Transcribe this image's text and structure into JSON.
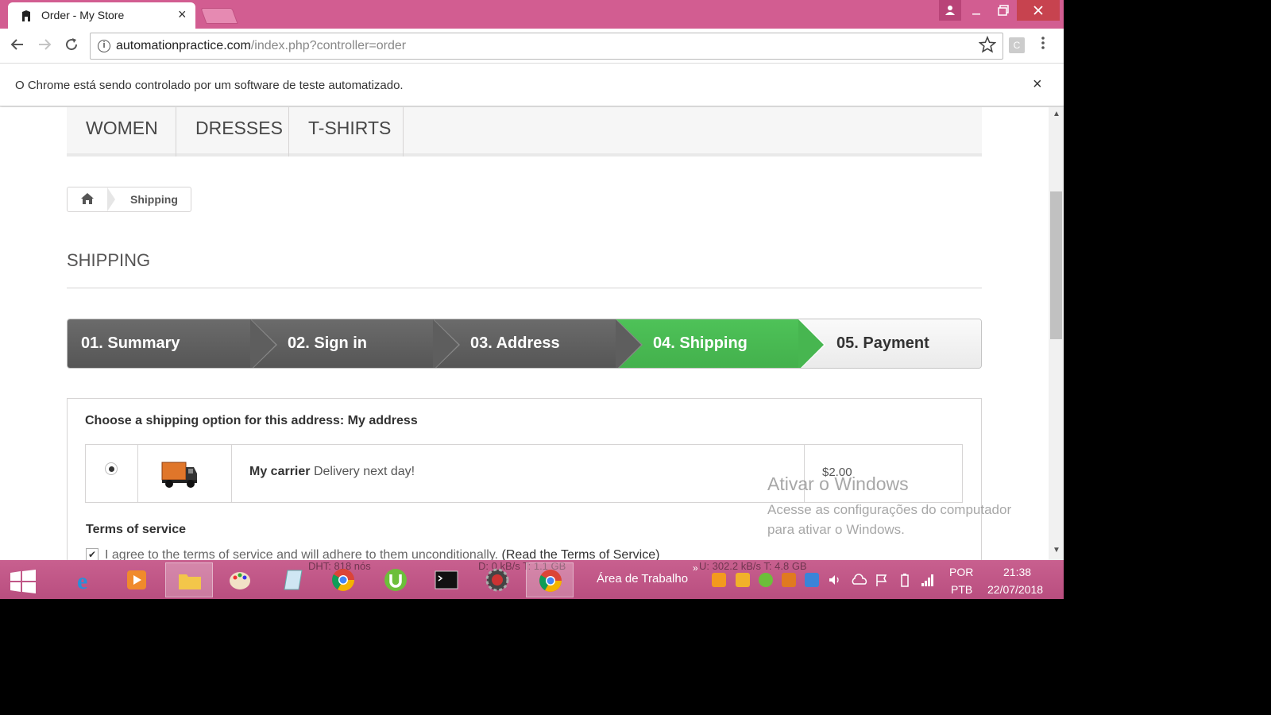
{
  "browser": {
    "tab_title": "Order - My Store",
    "tab_close": "×",
    "url_host": "automationpractice.com",
    "url_path": "/index.php?controller=order",
    "infobar_text": "O Chrome está sendo controlado por um software de teste automatizado.",
    "infobar_close": "×",
    "ext_label": "C"
  },
  "store": {
    "menu": [
      "WOMEN",
      "DRESSES",
      "T-SHIRTS"
    ],
    "breadcrumb_current": "Shipping",
    "page_heading": "SHIPPING",
    "steps": [
      {
        "label": "01. Summary",
        "state": "done"
      },
      {
        "label": "02. Sign in",
        "state": "done"
      },
      {
        "label": "03. Address",
        "state": "done"
      },
      {
        "label": "04. Shipping",
        "state": "current"
      },
      {
        "label": "05. Payment",
        "state": "todo"
      }
    ],
    "shipping_title": "Choose a shipping option for this address: My address",
    "carrier": {
      "name": "My carrier",
      "description": "Delivery next day!",
      "price": "$2.00",
      "selected": true
    },
    "terms_title": "Terms of service",
    "terms_text": "I agree to the terms of service and will adhere to them unconditionally.",
    "terms_link": "(Read the Terms of Service)",
    "terms_checked": true
  },
  "watermark": {
    "title": "Ativar o Windows",
    "subtitle": "Acesse as configurações do computador para ativar o Windows."
  },
  "taskbar": {
    "desktop_label": "Área de Trabalho",
    "chevron": "»",
    "lang_line1": "POR",
    "lang_line2": "PTB",
    "time": "21:38",
    "date": "22/07/2018",
    "ghost_dht": "DHT: 818 nós",
    "ghost_down": "D: 0 kB/s T: 1.1 GB",
    "ghost_up": "U: 302.2 kB/s T: 4.8 GB"
  },
  "colors": {
    "titlebar": "#d25d91",
    "step_done": "#5e5e5e",
    "step_current": "#47b650",
    "taskbar": "#c05a8a"
  }
}
